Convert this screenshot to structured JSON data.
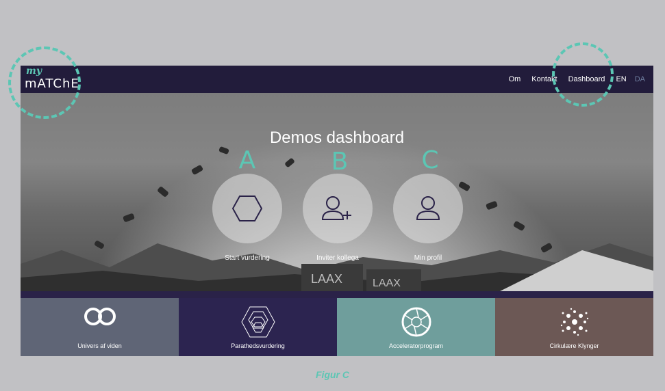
{
  "navbar": {
    "logo_top": "my",
    "logo_brand": "mATChE",
    "links": [
      "Om",
      "Kontakt",
      "Dashboard"
    ],
    "lang_en": "EN",
    "lang_da": "DA"
  },
  "hero": {
    "title": "Demos dashboard",
    "actions": [
      {
        "letter": "A",
        "label": "Start vurdering",
        "icon": "hexagon-icon"
      },
      {
        "letter": "B",
        "label": "Inviter kollega",
        "icon": "add-user-icon"
      },
      {
        "letter": "C",
        "label": "Min profil",
        "icon": "user-icon"
      }
    ],
    "banner_text": "LAAX"
  },
  "tiles": [
    {
      "label": "Univers af viden",
      "color": "#5f6576",
      "icon": "infinity-circles-icon"
    },
    {
      "label": "Parathedsvurdering",
      "color": "#2c2450",
      "icon": "hexagon-cluster-icon"
    },
    {
      "label": "Acceleratorprogram",
      "color": "#6f9e9c",
      "icon": "aperture-icon"
    },
    {
      "label": "Cirkulære Klynger",
      "color": "#6c5855",
      "icon": "dot-cluster-icon"
    }
  ],
  "caption": "Figur C",
  "colors": {
    "accent": "#5cc6b4",
    "navbar": "#221c3b"
  }
}
